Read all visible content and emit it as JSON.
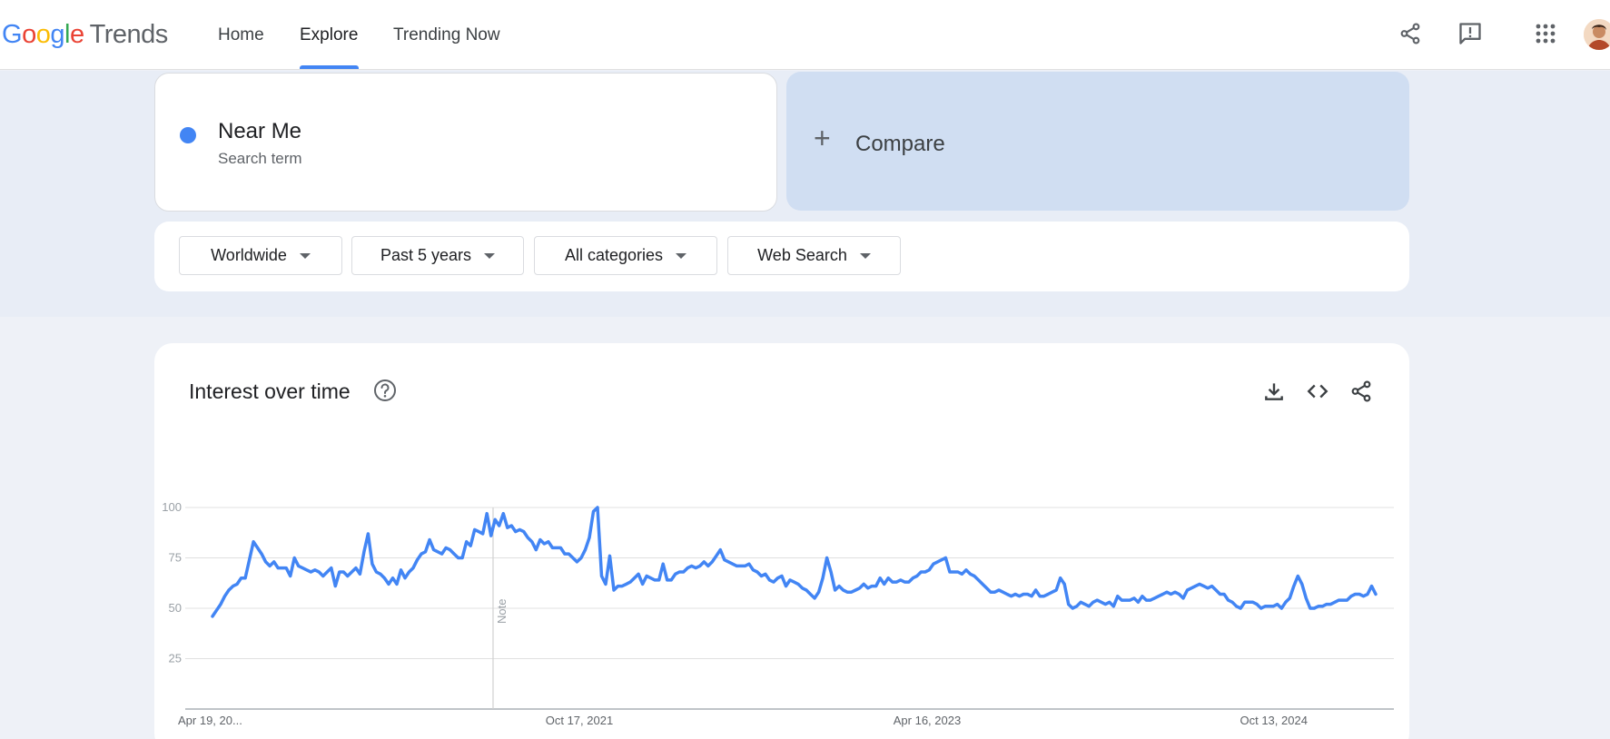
{
  "header": {
    "logo_parts": [
      "G",
      "o",
      "o",
      "g",
      "l",
      "e"
    ],
    "logo_product": "Trends",
    "nav": [
      {
        "label": "Home"
      },
      {
        "label": "Explore",
        "active": true
      },
      {
        "label": "Trending Now"
      }
    ],
    "icons": [
      "share-icon",
      "feedback-icon",
      "apps-grid-icon",
      "avatar"
    ]
  },
  "search": {
    "term": "Near Me",
    "term_type": "Search term",
    "term_color": "#4285f4",
    "compare_symbol": "+",
    "compare_label": "Compare"
  },
  "filters": [
    {
      "label": "Worldwide"
    },
    {
      "label": "Past 5 years"
    },
    {
      "label": "All categories"
    },
    {
      "label": "Web Search"
    }
  ],
  "chart_section": {
    "title": "Interest over time",
    "icons": [
      "help-icon",
      "download-icon",
      "embed-code-icon",
      "share-icon"
    ],
    "note_label": "Note"
  },
  "chart_data": {
    "type": "line",
    "title": "Interest over time",
    "xlabel": "",
    "ylabel": "",
    "ylim": [
      0,
      100
    ],
    "yticks": [
      25,
      50,
      75,
      100
    ],
    "x_tick_labels": [
      "Apr 19, 20...",
      "Oct 17, 2021",
      "Apr 16, 2023",
      "Oct 13, 2024"
    ],
    "grid": true,
    "note_marker_after_point": 68,
    "line_color": "#4285f4",
    "series": [
      {
        "values": [
          46,
          49,
          52,
          56,
          59,
          61,
          62,
          65,
          65,
          74,
          83,
          80,
          77,
          73,
          71,
          73,
          70,
          70,
          70,
          66,
          75,
          71,
          70,
          69,
          68,
          69,
          68,
          66,
          68,
          70,
          61,
          68,
          68,
          66,
          68,
          70,
          67,
          78,
          87,
          72,
          68,
          67,
          65,
          62,
          65,
          62,
          69,
          65,
          68,
          70,
          74,
          77,
          78,
          84,
          79,
          78,
          77,
          80,
          79,
          77,
          75,
          75,
          83,
          81,
          89,
          88,
          87,
          97,
          86,
          94,
          91,
          97,
          90,
          91,
          88,
          89,
          88,
          85,
          83,
          79,
          84,
          82,
          83,
          80,
          80,
          80,
          77,
          77,
          75,
          73,
          75,
          79,
          85,
          98,
          100,
          66,
          62,
          76,
          59,
          61,
          61,
          62,
          63,
          65,
          67,
          62,
          66,
          65,
          64,
          64,
          72,
          64,
          64,
          67,
          68,
          68,
          70,
          71,
          70,
          71,
          73,
          71,
          73,
          76,
          79,
          74,
          73,
          72,
          71,
          71,
          71,
          72,
          69,
          68,
          66,
          67,
          64,
          63,
          65,
          66,
          61,
          64,
          63,
          62,
          60,
          59,
          57,
          55,
          58,
          65,
          75,
          68,
          59,
          61,
          59,
          58,
          58,
          59,
          60,
          62,
          60,
          61,
          61,
          65,
          62,
          65,
          63,
          63,
          64,
          63,
          63,
          65,
          66,
          68,
          68,
          69,
          72,
          73,
          74,
          75,
          68,
          68,
          68,
          67,
          69,
          67,
          66,
          64,
          62,
          60,
          58,
          58,
          59,
          58,
          57,
          56,
          57,
          56,
          57,
          57,
          56,
          59,
          56,
          56,
          57,
          58,
          59,
          65,
          62,
          52,
          50,
          51,
          53,
          52,
          51,
          53,
          54,
          53,
          52,
          53,
          51,
          56,
          54,
          54,
          54,
          55,
          53,
          56,
          54,
          54,
          55,
          56,
          57,
          58,
          57,
          58,
          57,
          55,
          59,
          60,
          61,
          62,
          61,
          60,
          61,
          59,
          57,
          57,
          54,
          53,
          51,
          50,
          53,
          53,
          53,
          52,
          50,
          51,
          51,
          51,
          52,
          50,
          53,
          55,
          61,
          66,
          62,
          55,
          50,
          50,
          51,
          51,
          52,
          52,
          53,
          54,
          54,
          54,
          56,
          57,
          57,
          56,
          57,
          61,
          57
        ],
        "color": "#4285f4"
      }
    ]
  }
}
